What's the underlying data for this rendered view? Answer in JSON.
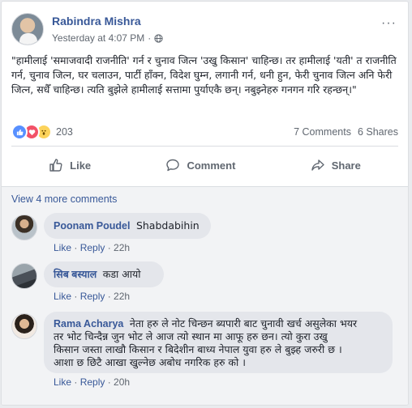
{
  "post": {
    "author": "Rabindra Mishra",
    "timestamp": "Yesterday at 4:07 PM",
    "separator": "·",
    "more_label": "···",
    "text": "\"हामीलाई 'समाजवादी राजनीति' गर्न र चुनाव जित्न 'उखु किसान' चाहिन्छ। तर हामीलाई 'यती' त राजनीति गर्न, चुनाव जित्न, घर चलाउन, पार्टी हाँक्न, विदेश घुम्न, लगानी गर्न, धनी हुन, फेरी चुनाव जित्न अनि फेरी जित्न, सधैँ चाहिन्छ। त्यति बुझेले हामीलाई सत्तामा पुर्याएकै छन्। नबुझ्नेहरु गनगन गरि रहन्छन्।\""
  },
  "stats": {
    "reaction_count": "203",
    "comments": "7 Comments",
    "shares": "6 Shares"
  },
  "actions": {
    "like": "Like",
    "comment": "Comment",
    "share": "Share"
  },
  "comments_section": {
    "view_more": "View 4 more comments",
    "items": [
      {
        "author": "Poonam Poudel",
        "text": "Shabdabihin",
        "like": "Like",
        "reply": "Reply",
        "time": "22h"
      },
      {
        "author": "सिब बस्याल",
        "text": "कडा आयो",
        "like": "Like",
        "reply": "Reply",
        "time": "22h"
      },
      {
        "author": "Rama Acharya",
        "text_line1": "नेता हरु ले नोट चिन्छन ब्यपारी बाट चुनावी खर्च असुलेका भयर",
        "text_line2": "तर भोट चिन्दैन्न जुन भोट ले आज त्यो स्थान मा आफू हरु छन। त्यो कुरा उखु",
        "text_line3": "किसान जस्ता लाखौ किसान र बिदेशीन बाध्य नेपाल युवा हरु ले बुझ्ह जरुरी छ ।",
        "text_line4": "आशा छ छिटै आखा खुल्नेछ अबोध नगरिक हरु को ।",
        "like": "Like",
        "reply": "Reply",
        "time": "20h"
      }
    ]
  },
  "colors": {
    "link": "#385898",
    "secondary_text": "#606770",
    "bubble": "#e4e6eb"
  }
}
